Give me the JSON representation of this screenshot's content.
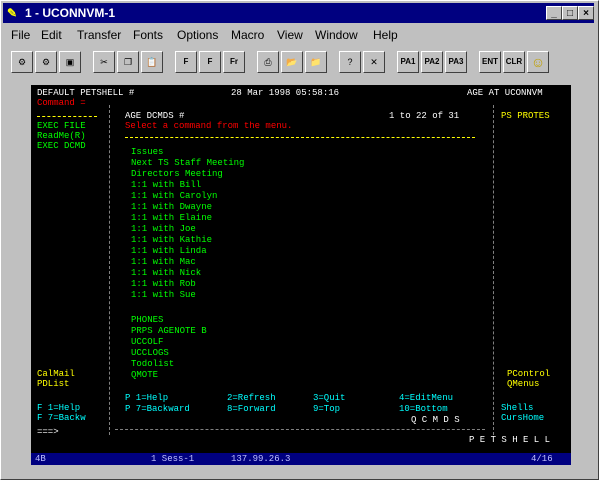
{
  "window": {
    "title": "1 - UCONNVM-1",
    "controls": {
      "minimize": "_",
      "maximize": "□",
      "close": "×"
    }
  },
  "menu": [
    "File",
    "Edit",
    "Transfer",
    "Fonts",
    "Options",
    "Macro",
    "View",
    "Window",
    "Help"
  ],
  "toolbar": {
    "pf1": "PA1",
    "pf2": "PA2",
    "pf3": "PA3",
    "ent": "ENT",
    "clr": "CLR",
    "fonts": [
      "F",
      "F",
      "Fr"
    ]
  },
  "terminal": {
    "header_left": "DEFAULT PETSHELL #",
    "header_date": "28 Mar 1998 05:58:16",
    "header_right": "AGE AT UCONNVM",
    "command_label": "Command =",
    "left_menu": [
      "EXEC FILE",
      "ReadMe(R)",
      "EXEC DCMD"
    ],
    "panel_title": "AGE DCMDS #",
    "panel_range": "1 to 22 of 31",
    "panel_prompt": "Select a command from the menu.",
    "right_title": "PS PROTES",
    "items": [
      "Issues",
      "Next TS Staff Meeting",
      "Directors Meeting",
      "1:1 with Bill",
      "1:1 with Carolyn",
      "1:1 with Dwayne",
      "1:1 with Elaine",
      "1:1 with Joe",
      "1:1 with Kathie",
      "1:1 with Linda",
      "1:1 with Mac",
      "1:1 with Nick",
      "1:1 with Rob",
      "1:1 with Sue"
    ],
    "items2": [
      "PHONES",
      "PRPS AGENOTE B",
      "UCCOLF",
      "UCCLOGS",
      "Todolist",
      "QMOTE"
    ],
    "left_bottom": [
      "CalMail",
      "PDList"
    ],
    "right_bottom": [
      "PControl",
      "QMenus"
    ],
    "pf_keys_row1": [
      "P 1=Help",
      "2=Refresh",
      "3=Quit",
      "4=EditMenu"
    ],
    "pf_keys_row2": [
      "P 7=Backward",
      "8=Forward",
      "9=Top",
      "10=Bottom"
    ],
    "left_pf": [
      "F 1=Help",
      "F 7=Backw"
    ],
    "right_pf": [
      "Shells",
      "CursHome"
    ],
    "qcmds": "Q C M D S",
    "footer_brand": "P E T S H E L L",
    "arrow": "===>"
  },
  "statusbar": {
    "left": "4B",
    "session": "1 Sess-1",
    "address": "137.99.26.3",
    "position": "4/16"
  },
  "colors": {
    "titlebar": "#000080",
    "terminal_bg": "#000000",
    "green": "#00ff00",
    "yellow": "#ffff00",
    "red": "#ff0000",
    "cyan": "#00ffff"
  }
}
